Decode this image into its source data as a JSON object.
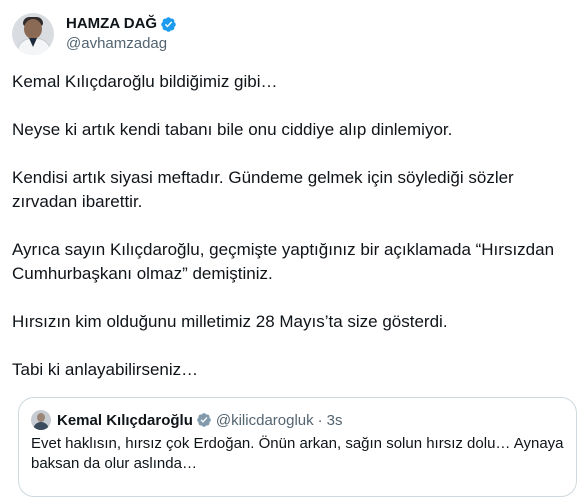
{
  "author": {
    "display_name": "HAMZA DAĞ",
    "handle": "@avhamzadag",
    "avatar": "profile-photo",
    "verified_icon": "verified-badge-icon"
  },
  "tweet": {
    "paragraphs": [
      "Kemal Kılıçdaroğlu bildiğimiz gibi…",
      "Neyse ki artık kendi tabanı bile onu ciddiye alıp dinlemiyor.",
      "Kendisi artık siyasi meftadır.  Gündeme gelmek için söylediği sözler zırvadan ibarettir.",
      "Ayrıca sayın Kılıçdaroğlu, geçmişte yaptığınız bir açıklamada “Hırsızdan Cumhurbaşkanı olmaz” demiştiniz.",
      "Hırsızın kim olduğunu milletimiz 28 Mayıs’ta size gösterdi.",
      "Tabi ki anlayabilirseniz…"
    ]
  },
  "quoted_tweet": {
    "display_name": "Kemal Kılıçdaroğlu",
    "handle": "@kilicdarogluk",
    "separator": "·",
    "time": "3s",
    "text": "Evet haklısın, hırsız çok Erdoğan. Önün arkan, sağın solun hırsız dolu… Aynaya baksan da olur aslında…"
  },
  "colors": {
    "verified_blue": "#1d9bf0",
    "text_primary": "#0f1419",
    "text_secondary": "#536471",
    "border": "#cfd9de"
  }
}
